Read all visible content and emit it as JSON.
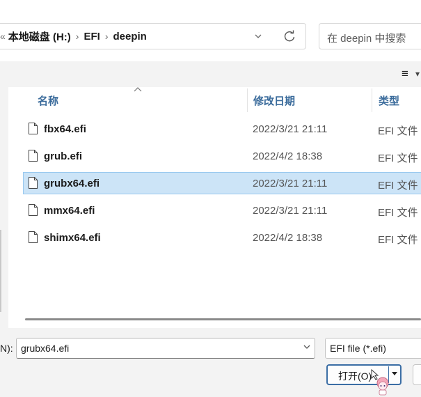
{
  "address": {
    "lead": "«",
    "crumbs": [
      "本地磁盘 (H:)",
      "EFI",
      "deepin"
    ],
    "separator": "›"
  },
  "search": {
    "placeholder": "在 deepin 中搜索"
  },
  "toolbar": {
    "view_icon": "list-view-icon"
  },
  "columns": {
    "name": "名称",
    "date": "修改日期",
    "type": "类型"
  },
  "files": [
    {
      "name": "fbx64.efi",
      "date": "2022/3/21 21:11",
      "type": "EFI 文件",
      "selected": false
    },
    {
      "name": "grub.efi",
      "date": "2022/4/2 18:38",
      "type": "EFI 文件",
      "selected": false
    },
    {
      "name": "grubx64.efi",
      "date": "2022/3/21 21:11",
      "type": "EFI 文件",
      "selected": true
    },
    {
      "name": "mmx64.efi",
      "date": "2022/3/21 21:11",
      "type": "EFI 文件",
      "selected": false
    },
    {
      "name": "shimx64.efi",
      "date": "2022/4/2 18:38",
      "type": "EFI 文件",
      "selected": false
    }
  ],
  "footer": {
    "filename_label": "N):",
    "filename_value": "grubx64.efi",
    "filter_value": "EFI file (*.efi)",
    "open_label": "打开(O)"
  },
  "colors": {
    "selection_bg": "#cce4f7",
    "selection_border": "#99c9ef",
    "header_text": "#3a6b9b",
    "accent": "#3b6ea5"
  }
}
